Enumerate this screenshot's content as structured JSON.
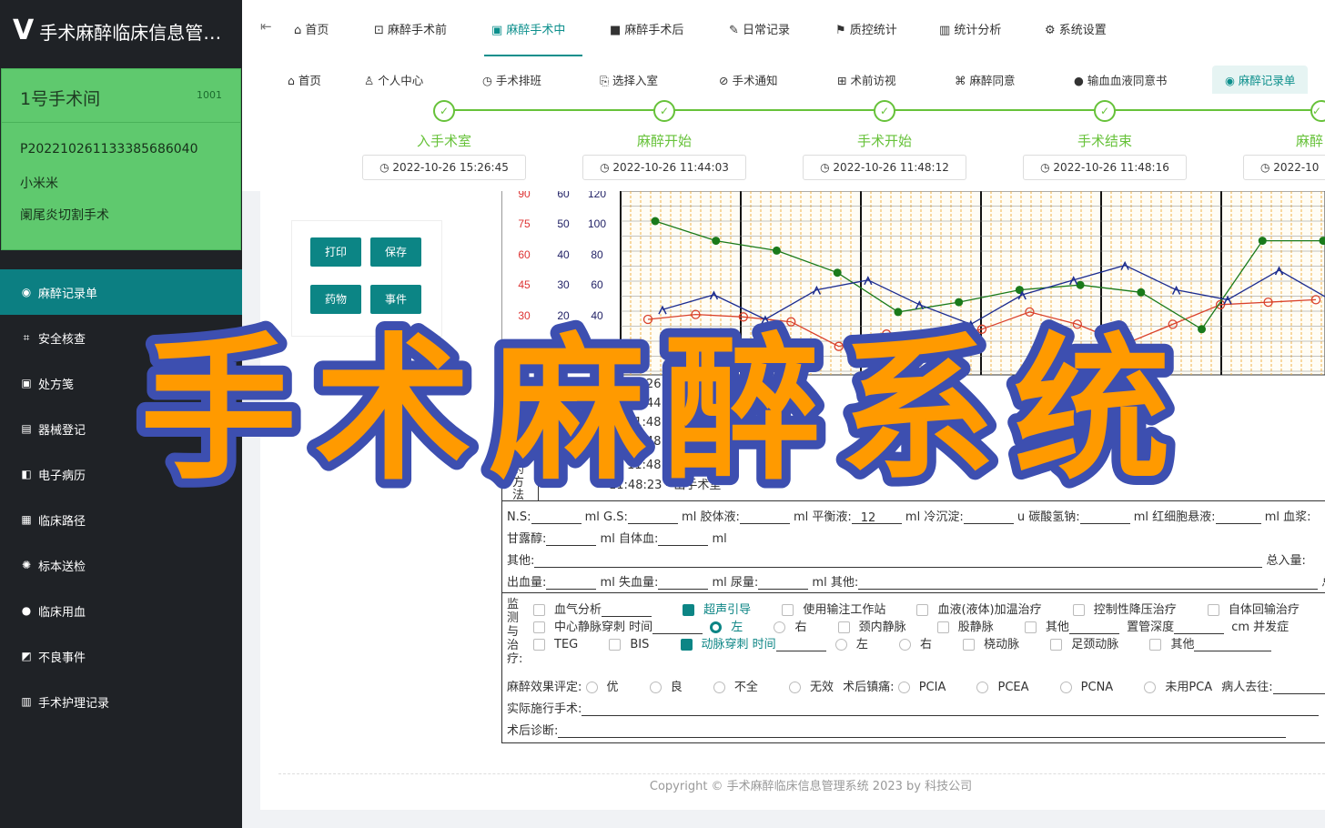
{
  "app": {
    "logo_glyph": "V",
    "title": "手术麻醉临床信息管理系统"
  },
  "room": {
    "name": "1号手术间",
    "code": "1001",
    "patient_id": "P20221026113338568604​0",
    "patient_name": "小米米",
    "operation": "阑尾炎切割手术"
  },
  "sidebar": {
    "items": [
      {
        "label": "麻醉记录单",
        "icon": "record-icon",
        "active": true
      },
      {
        "label": "安全核查",
        "icon": "check-icon"
      },
      {
        "label": "处方笺",
        "icon": "prescription-icon"
      },
      {
        "label": "器械登记",
        "icon": "instrument-icon"
      },
      {
        "label": "电子病历",
        "icon": "emr-icon"
      },
      {
        "label": "临床路径",
        "icon": "pathway-icon"
      },
      {
        "label": "标本送检",
        "icon": "specimen-icon"
      },
      {
        "label": "临床用血",
        "icon": "blood-icon"
      },
      {
        "label": "不良事件",
        "icon": "event-icon"
      },
      {
        "label": "手术护理记录",
        "icon": "nursing-icon"
      }
    ]
  },
  "topnav": {
    "collapse_glyph": "⇤",
    "items": [
      {
        "label": "首页",
        "icon": "home-icon"
      },
      {
        "label": "麻醉手术前",
        "icon": "pre-op-icon"
      },
      {
        "label": "麻醉手术中",
        "icon": "in-op-icon",
        "active": true
      },
      {
        "label": "麻醉手术后",
        "icon": "post-op-icon"
      },
      {
        "label": "日常记录",
        "icon": "pen-icon"
      },
      {
        "label": "质控统计",
        "icon": "flag-icon"
      },
      {
        "label": "统计分析",
        "icon": "bar-chart-icon"
      },
      {
        "label": "系统设置",
        "icon": "gear-icon"
      }
    ]
  },
  "subnav": {
    "items": [
      {
        "label": "首页",
        "icon": "home-icon"
      },
      {
        "label": "个人中心",
        "icon": "user-icon"
      },
      {
        "label": "手术排班",
        "icon": "schedule-icon"
      },
      {
        "label": "选择入室",
        "icon": "enter-icon"
      },
      {
        "label": "手术通知",
        "icon": "notice-icon"
      },
      {
        "label": "术前访视",
        "icon": "visit-icon"
      },
      {
        "label": "麻醉同意",
        "icon": "consent-icon"
      },
      {
        "label": "输血血液同意书",
        "icon": "drop-icon"
      },
      {
        "label": "麻醉记录单",
        "icon": "record-icon",
        "active": true
      }
    ]
  },
  "steps": [
    {
      "label": "入手术室",
      "time": "2022-10-26 15:26:45"
    },
    {
      "label": "麻醉开始",
      "time": "2022-10-26 11:44:03"
    },
    {
      "label": "手术开始",
      "time": "2022-10-26 11:48:12"
    },
    {
      "label": "手术结束",
      "time": "2022-10-26 11:48:16"
    },
    {
      "label": "麻醉",
      "time": "2022-10"
    }
  ],
  "actions": {
    "print": "打印",
    "save": "保存",
    "drug": "药物",
    "event": "事件"
  },
  "chart_data": {
    "type": "line",
    "y_axes": [
      {
        "ticks": [
          "90",
          "75",
          "60",
          "45",
          "30",
          "15"
        ],
        "color": "#d33"
      },
      {
        "ticks": [
          "60",
          "50",
          "40",
          "30",
          "20"
        ],
        "color": "#226"
      },
      {
        "ticks": [
          "120",
          "100",
          "80",
          "60",
          "40"
        ],
        "color": "#226"
      }
    ],
    "series": [
      {
        "marker": "red-circle",
        "color": "#d9412b",
        "values": [
          30,
          32,
          31,
          29,
          19,
          24,
          22,
          26,
          33,
          28,
          20,
          28,
          36,
          37,
          38
        ]
      },
      {
        "marker": "green-dot",
        "color": "#1a7a1a",
        "values": [
          70,
          62,
          58,
          49,
          33,
          37,
          42,
          44,
          41,
          26,
          62,
          62
        ]
      },
      {
        "marker": "blue-caret",
        "color": "#1c2c8f",
        "values": [
          34,
          40,
          30,
          42,
          46,
          36,
          28,
          40,
          46,
          52,
          42,
          38,
          50,
          38
        ]
      }
    ]
  },
  "timeline": {
    "events": [
      "15:26:45",
      "11:44:03",
      "11:48:12",
      "11:48:1",
      "11:48:19 - 麻醉结",
      "11:48:23 - 出手术室"
    ],
    "side_label": [
      "药",
      "方",
      "法"
    ]
  },
  "form": {
    "fluids": {
      "ns": "N.S:",
      "gs": "ml G.S:",
      "colloid": "ml 胶体液:",
      "balance": "ml 平衡液:",
      "balance_value": "12",
      "cryo": "ml 冷沉淀:",
      "bicarb": "u 碳酸氢钠:",
      "rbc": "ml 红细胞悬液:",
      "plasma": "ml 血浆:"
    },
    "fluids2": {
      "mannitol": "甘露醇:",
      "auto": "ml 自体血:",
      "ml": "ml"
    },
    "other": {
      "label": "其他:",
      "total": "总入量:"
    },
    "output": {
      "blood": "出血量:",
      "loss": "ml 失血量:",
      "urine": "ml 尿量:",
      "other": "ml 其他:",
      "total": "总"
    },
    "monitor_label": [
      "监",
      "测",
      "与",
      "治",
      "疗:"
    ],
    "monitor_row1": [
      "血气分析",
      "超声引导",
      "使用输注工作站",
      "血液(液体)加温治疗",
      "控制性降压治疗",
      "自体回输治疗"
    ],
    "monitor_row2": [
      "中心静脉穿刺 时间",
      "左",
      "右",
      "颈内静脉",
      "股静脉",
      "其他",
      "置管深度",
      "cm 并发症"
    ],
    "monitor_row3": [
      "TEG",
      "BIS",
      "动脉穿刺 时间",
      "左",
      "右",
      "桡动脉",
      "足颈动脉",
      "其他"
    ],
    "effect": {
      "label": "麻醉效果评定:",
      "options": [
        "优",
        "良",
        "不全",
        "无效"
      ],
      "post_label": "术后镇痛:",
      "post_options": [
        "PCIA",
        "PCEA",
        "PCNA",
        "未用PCA"
      ],
      "dest": "病人去往:"
    },
    "actual_op": "实际施行手术:",
    "post_diag": "术后诊断:"
  },
  "footer": {
    "text": "Copyright © 手术麻醉临床信息管理系统 2023 by 科技公司"
  },
  "watermark": {
    "text": "手术麻醉系统",
    "fill": "#ff9a00",
    "stroke": "#3d4fb0"
  }
}
